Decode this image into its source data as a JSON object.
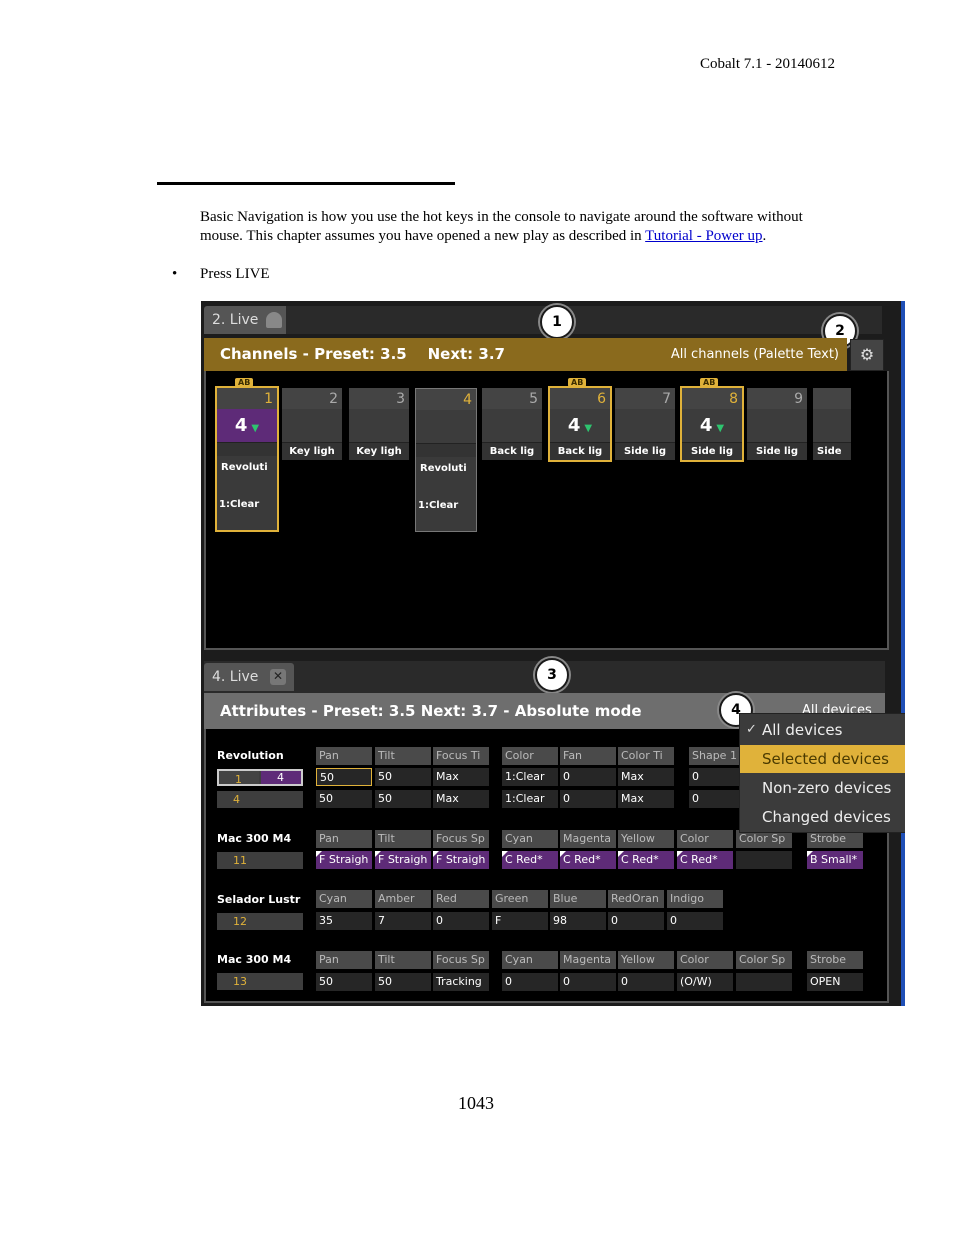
{
  "header": "Cobalt 7.1 - 20140612",
  "intro": {
    "text_before": "Basic Navigation is how you use the hot keys in the console to navigate around the software without mouse. This chapter assumes you have opened a new play as described in ",
    "link": "Tutorial - Power up",
    "text_after": "."
  },
  "bullet": "Press LIVE",
  "page_number": "1043",
  "screenshot": {
    "top_tab": "2. Live",
    "top_bar_title": "Channels - Preset: 3.5    Next: 3.7",
    "top_bar_right": "All channels (Palette Text)",
    "callouts": [
      "1",
      "2",
      "3",
      "4"
    ],
    "channels": [
      {
        "num": "1",
        "ab": "AB",
        "value": "4",
        "label": "",
        "ext1": "Revoluti",
        "ext2": "1:Clear"
      },
      {
        "num": "2",
        "ab": "",
        "value": "",
        "label": "Key ligh",
        "ext1": "",
        "ext2": ""
      },
      {
        "num": "3",
        "ab": "",
        "value": "",
        "label": "Key ligh",
        "ext1": "",
        "ext2": ""
      },
      {
        "num": "4",
        "ab": "",
        "value": "",
        "label": "",
        "ext1": "Revoluti",
        "ext2": "1:Clear"
      },
      {
        "num": "5",
        "ab": "",
        "value": "",
        "label": "Back lig",
        "ext1": "",
        "ext2": ""
      },
      {
        "num": "6",
        "ab": "AB",
        "value": "4",
        "label": "Back lig",
        "ext1": "",
        "ext2": ""
      },
      {
        "num": "7",
        "ab": "",
        "value": "",
        "label": "Side lig",
        "ext1": "",
        "ext2": ""
      },
      {
        "num": "8",
        "ab": "AB",
        "value": "4",
        "label": "Side lig",
        "ext1": "",
        "ext2": ""
      },
      {
        "num": "9",
        "ab": "",
        "value": "",
        "label": "Side lig",
        "ext1": "",
        "ext2": ""
      },
      {
        "num": "",
        "ab": "",
        "value": "",
        "label": "Side",
        "ext1": "",
        "ext2": ""
      }
    ],
    "bottom_tab": "4. Live",
    "attr_bar_title": "Attributes - Preset: 3.5 Next: 3.7 - Absolute mode",
    "attr_bar_right": "All devices",
    "menu": [
      "All devices",
      "Selected devices",
      "Non-zero devices",
      "Changed devices"
    ],
    "devices": {
      "revolution": {
        "name": "Revolution",
        "ids": [
          "1",
          "4"
        ],
        "id2": "4",
        "headers": [
          "Pan",
          "Tilt",
          "Focus Ti",
          "Color",
          "Fan",
          "Color Ti",
          "Shape 1"
        ],
        "row1": [
          "50",
          "50",
          "Max",
          "1:Clear",
          "0",
          "Max",
          "0"
        ],
        "row2": [
          "50",
          "50",
          "Max",
          "1:Clear",
          "0",
          "Max",
          "0"
        ]
      },
      "mac1": {
        "name": "Mac 300 M4",
        "id": "11",
        "headers": [
          "Pan",
          "Tilt",
          "Focus Sp",
          "Cyan",
          "Magenta",
          "Yellow",
          "Color",
          "Color Sp",
          "Strobe"
        ],
        "values": [
          "F Straigh",
          "F Straigh",
          "F Straigh",
          "C Red*",
          "C Red*",
          "C Red*",
          "C Red*",
          "",
          "B Small*"
        ]
      },
      "selador": {
        "name": "Selador Lustr",
        "id": "12",
        "headers": [
          "Cyan",
          "Amber",
          "Red",
          "Green",
          "Blue",
          "RedOran",
          "Indigo"
        ],
        "values": [
          "35",
          "7",
          "0",
          "F",
          "98",
          "0",
          "0"
        ]
      },
      "mac2": {
        "name": "Mac 300 M4",
        "id": "13",
        "headers": [
          "Pan",
          "Tilt",
          "Focus Sp",
          "Cyan",
          "Magenta",
          "Yellow",
          "Color",
          "Color Sp",
          "Strobe"
        ],
        "values": [
          "50",
          "50",
          "Tracking",
          "0",
          "0",
          "0",
          "(O/W)",
          "",
          "OPEN"
        ]
      }
    }
  }
}
